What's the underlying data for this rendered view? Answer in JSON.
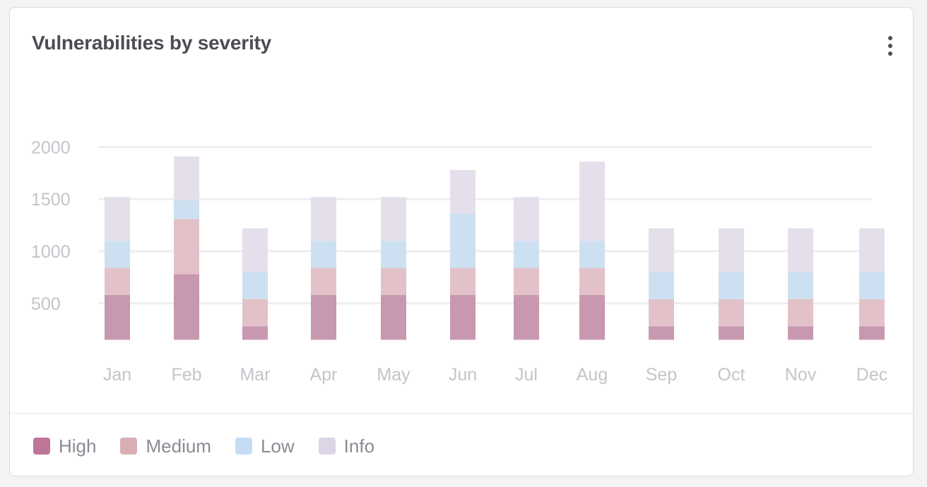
{
  "card": {
    "title": "Vulnerabilities by severity",
    "menu_icon": "more-vertical-icon"
  },
  "colors": {
    "High": "#c897b0",
    "Medium": "#e2c2c8",
    "Low": "#cde0f1",
    "Info": "#e4dfeb",
    "legend_High": "#bf7597",
    "legend_Medium": "#d9aeb4",
    "legend_Low": "#c5dcf3",
    "legend_Info": "#dcd5e6",
    "gridline": "#eeeef1",
    "axis_text": "#c4c4cb"
  },
  "legend": [
    {
      "label": "High",
      "color_key": "legend_High"
    },
    {
      "label": "Medium",
      "color_key": "legend_Medium"
    },
    {
      "label": "Low",
      "color_key": "legend_Low"
    },
    {
      "label": "Info",
      "color_key": "legend_Info"
    }
  ],
  "chart_data": {
    "type": "bar",
    "stacked": true,
    "title": "Vulnerabilities by severity",
    "xlabel": "",
    "ylabel": "",
    "categories": [
      "Jan",
      "Feb",
      "Mar",
      "Apr",
      "May",
      "Jun",
      "Jul",
      "Aug",
      "Sep",
      "Oct",
      "Nov",
      "Dec"
    ],
    "yticks": [
      500,
      1000,
      1500,
      2000
    ],
    "ylim": [
      150,
      2000
    ],
    "grid": true,
    "legend_position": "bottom-left",
    "series": [
      {
        "name": "High",
        "values": [
          430,
          630,
          130,
          430,
          430,
          430,
          430,
          430,
          130,
          130,
          130,
          130
        ]
      },
      {
        "name": "Medium",
        "values": [
          260,
          530,
          260,
          260,
          260,
          260,
          260,
          260,
          260,
          260,
          260,
          260
        ]
      },
      {
        "name": "Low",
        "values": [
          260,
          180,
          260,
          260,
          260,
          520,
          260,
          260,
          260,
          260,
          260,
          260
        ]
      },
      {
        "name": "Info",
        "values": [
          420,
          420,
          420,
          420,
          420,
          420,
          420,
          760,
          420,
          420,
          420,
          420
        ]
      }
    ]
  }
}
